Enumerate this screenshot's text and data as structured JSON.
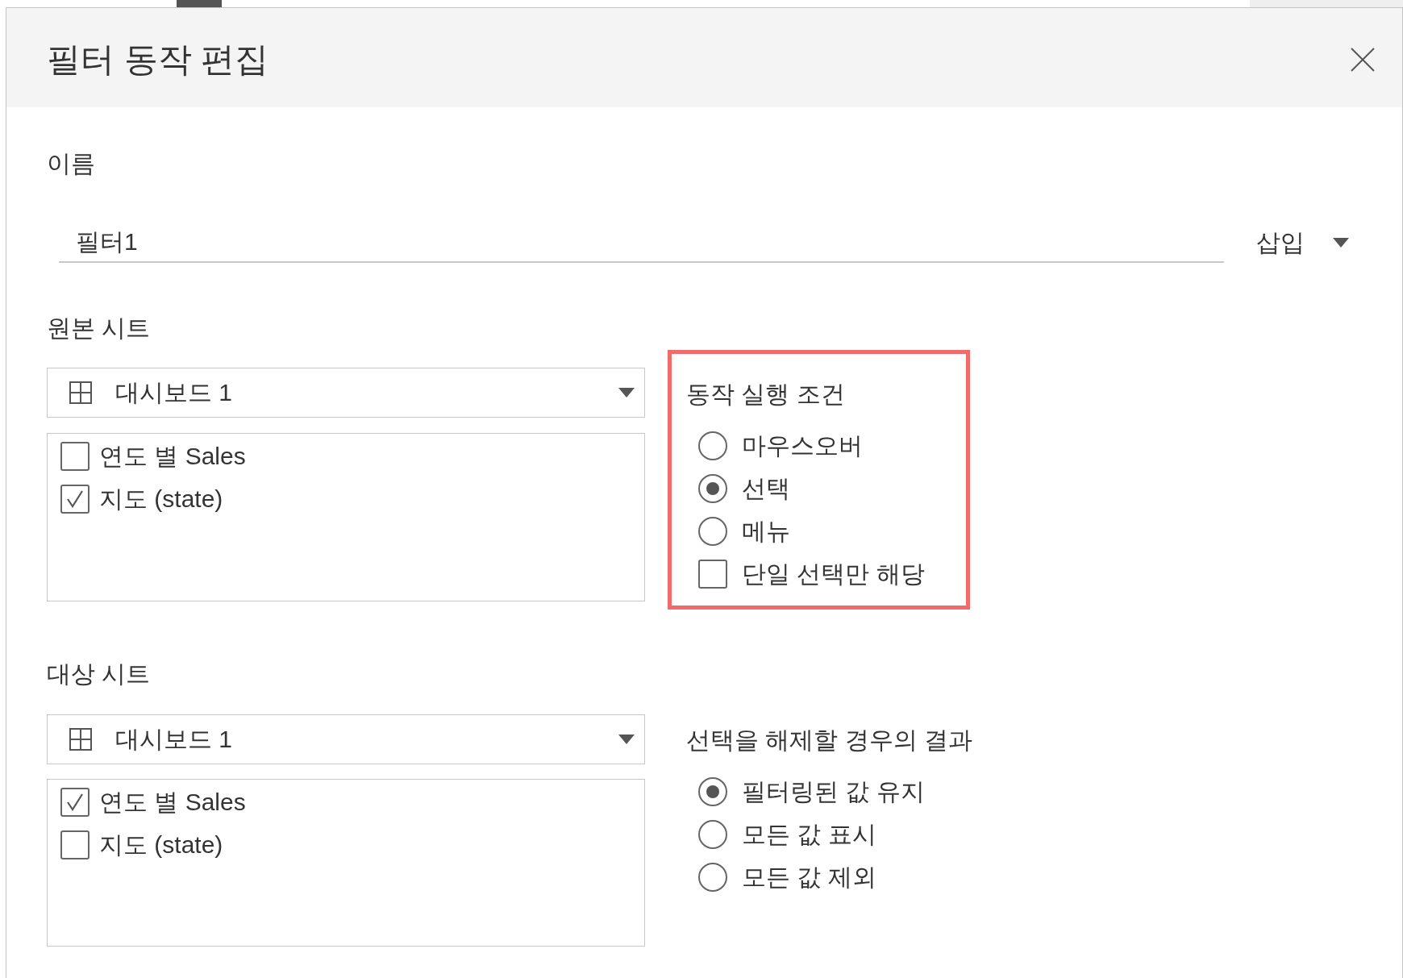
{
  "window": {
    "title": "필터 동작 편집"
  },
  "name": {
    "label": "이름",
    "value": "필터1",
    "insert_menu": "삽입"
  },
  "source_sheets": {
    "label": "원본 시트",
    "dropdown": "대시보드 1",
    "sheets": [
      {
        "label": "연도 별 Sales",
        "checked": false
      },
      {
        "label": "지도 (state)",
        "checked": true
      }
    ]
  },
  "run_action_on": {
    "highlighted": true,
    "label": "동작 실행 조건",
    "options": [
      {
        "label": "마우스오버",
        "selected": false
      },
      {
        "label": "선택",
        "selected": true
      },
      {
        "label": "메뉴",
        "selected": false
      }
    ],
    "single_select_only": {
      "label": "단일 선택만 해당",
      "checked": false
    }
  },
  "target_sheets": {
    "label": "대상 시트",
    "dropdown": "대시보드 1",
    "sheets": [
      {
        "label": "연도 별 Sales",
        "checked": true
      },
      {
        "label": "지도 (state)",
        "checked": false
      }
    ]
  },
  "clearing_selection": {
    "label": "선택을 해제할 경우의 결과",
    "options": [
      {
        "label": "필터링된 값 유지",
        "selected": true
      },
      {
        "label": "모든 값 표시",
        "selected": false
      },
      {
        "label": "모든 값 제외",
        "selected": false
      }
    ]
  }
}
